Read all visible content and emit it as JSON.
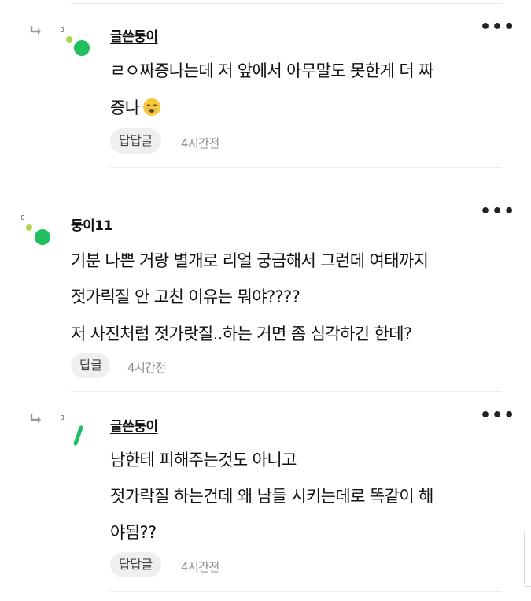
{
  "comments": [
    {
      "author": "글쓴둥이",
      "is_reply": true,
      "lines": [
        "ㄹㅇ짜증나는데 저 앞에서 아무말도 못한게 더 짜",
        "증나"
      ],
      "emoji": "crying-face",
      "reply_label": "답답글",
      "time": "4시간전"
    },
    {
      "author": "둥이11",
      "is_reply": false,
      "lines": [
        "기분 나쁜 거랑 별개로 리얼 궁금해서 그런데 여태까지",
        "젓가릭질 안 고친 이유는 뭐야????",
        "저 사진처럼 젓가랏질..하는 거면 좀 심각하긴 한데?"
      ],
      "reply_label": "답글",
      "time": "4시간전"
    },
    {
      "author": "글쓴둥이",
      "is_reply": true,
      "lines": [
        "남한테 피해주는것도 아니고",
        "젓가락질 하는건데 왜 남들 시키는데로 똑같이 해",
        "야됨??"
      ],
      "reply_label": "답답글",
      "time": "4시간전"
    }
  ],
  "more_label": "•••",
  "colors": {
    "accent_green": "#1fbf5f",
    "light_green": "#a8d84a",
    "divider": "#ececec"
  }
}
